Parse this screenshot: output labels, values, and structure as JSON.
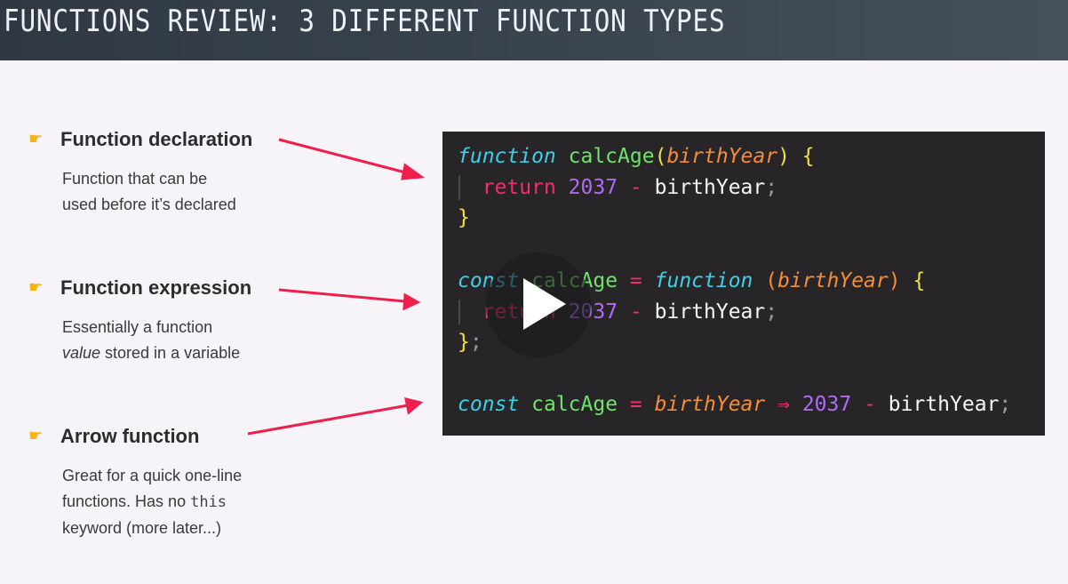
{
  "header": {
    "title": "FUNCTIONS REVIEW: 3 DIFFERENT FUNCTION TYPES"
  },
  "items": [
    {
      "icon": "pointing-hand-icon",
      "heading": "Function declaration",
      "desc_line1": "Function that can be",
      "desc_line2": "used before it’s declared"
    },
    {
      "icon": "pointing-hand-icon",
      "heading": "Function expression",
      "desc_line1": "Essentially a function",
      "desc_line2_em": "value",
      "desc_line2_rest": " stored in a variable"
    },
    {
      "icon": "pointing-hand-icon",
      "heading": "Arrow function",
      "desc_line1": "Great for a quick one-line",
      "desc_line2_a": "functions. Has no ",
      "desc_line2_code": "this",
      "desc_line3": "keyword (more later...)"
    }
  ],
  "code": {
    "declaration": {
      "kw": "function",
      "name": "calcAge",
      "open_paren": "(",
      "param": "birthYear",
      "close_paren": ")",
      "open_brace": "{",
      "ret": "return",
      "num": "2037",
      "op": "-",
      "ident": "birthYear",
      "semi": ";",
      "close_brace": "}"
    },
    "expression": {
      "kw": "const",
      "name": "calcAge",
      "eq": "=",
      "fn_kw": "function",
      "open_paren": "(",
      "param": "birthYear",
      "close_paren": ")",
      "open_brace": "{",
      "ret": "return",
      "num": "2037",
      "op": "-",
      "ident": "birthYear",
      "semi": ";",
      "close_brace": "}",
      "end_semi": ";"
    },
    "arrow": {
      "kw": "const",
      "name": "calcAge",
      "eq": "=",
      "param": "birthYear",
      "arrow": "⇒",
      "num": "2037",
      "op": "-",
      "ident": "birthYear",
      "semi": ";"
    }
  },
  "player": {
    "play_icon": "play-icon"
  },
  "colors": {
    "code_bg": "#272528",
    "keyword": "#3cd0e6",
    "function_name": "#6fe26a",
    "param": "#f58d34",
    "brace": "#f3e03a",
    "return": "#f22f6c",
    "number": "#b06cf0",
    "arrow_pointer": "#ee1f4d",
    "hand_icon": "#f2b418"
  }
}
